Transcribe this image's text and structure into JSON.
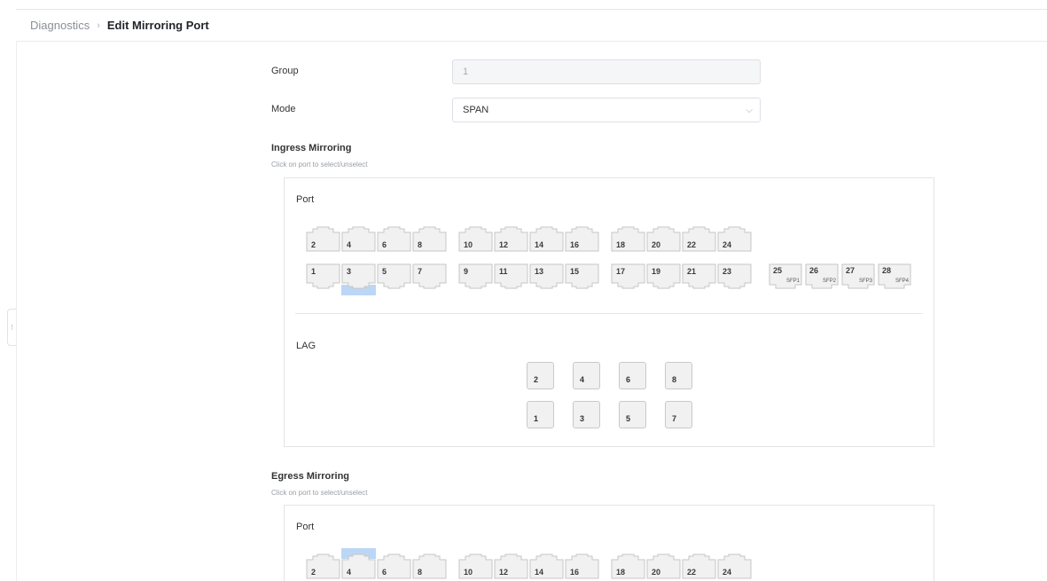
{
  "breadcrumb": {
    "parent": "Diagnostics",
    "separator": "›",
    "current": "Edit Mirroring Port"
  },
  "form": {
    "group": {
      "label": "Group",
      "value": "1"
    },
    "mode": {
      "label": "Mode",
      "value": "SPAN"
    }
  },
  "ingress": {
    "title": "Ingress Mirroring",
    "hint": "Click on port to select/unselect",
    "port_label": "Port",
    "lag_label": "LAG",
    "top_ports": [
      "2",
      "4",
      "6",
      "8",
      "10",
      "12",
      "14",
      "16",
      "18",
      "20",
      "22",
      "24"
    ],
    "bottom_ports": [
      "1",
      "3",
      "5",
      "7",
      "9",
      "11",
      "13",
      "15",
      "17",
      "19",
      "21",
      "23"
    ],
    "selected_ports": [
      "3"
    ],
    "sfp_ports": [
      {
        "num": "25",
        "label": "SFP1"
      },
      {
        "num": "26",
        "label": "SFP2"
      },
      {
        "num": "27",
        "label": "SFP3"
      },
      {
        "num": "28",
        "label": "SFP4"
      }
    ],
    "lag_top": [
      "2",
      "4",
      "6",
      "8"
    ],
    "lag_bottom": [
      "1",
      "3",
      "5",
      "7"
    ]
  },
  "egress": {
    "title": "Egress Mirroring",
    "hint": "Click on port to select/unselect",
    "port_label": "Port",
    "top_ports": [
      "2",
      "4",
      "6",
      "8",
      "10",
      "12",
      "14",
      "16",
      "18",
      "20",
      "22",
      "24"
    ],
    "selected_ports": [
      "4"
    ]
  },
  "colors": {
    "selected": "#bcd7f5",
    "port_fill": "#f1f1f1",
    "port_stroke": "#c6c6c6"
  }
}
